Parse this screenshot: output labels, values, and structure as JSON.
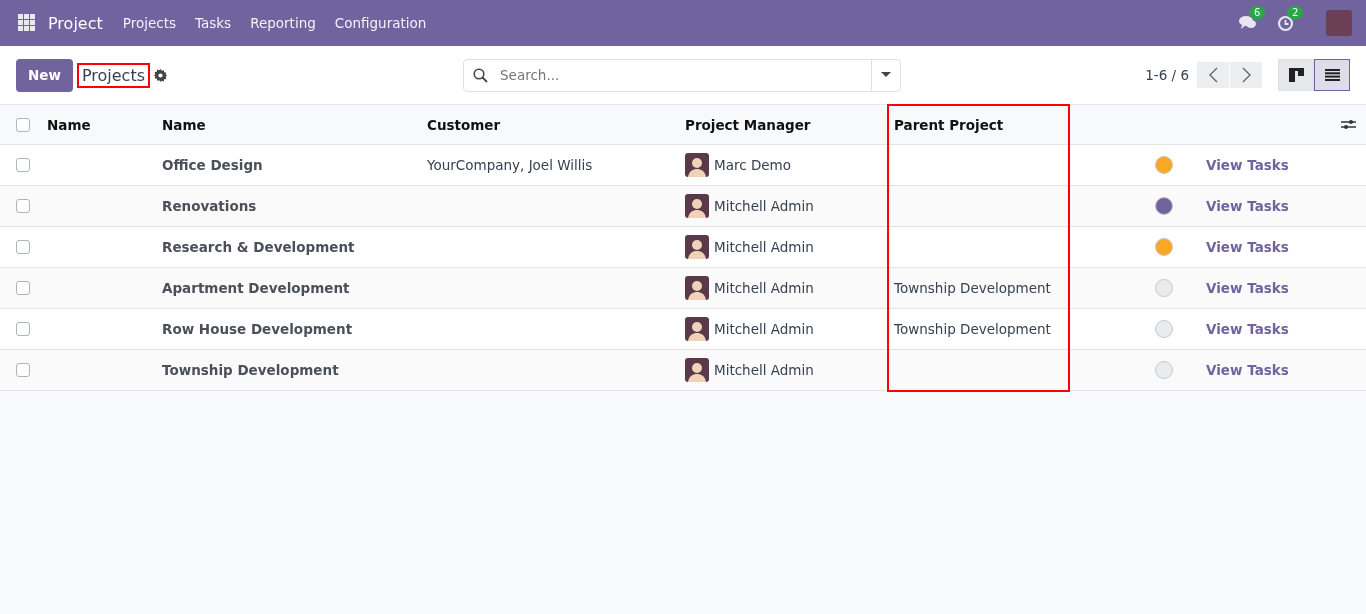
{
  "navbar": {
    "app_name": "Project",
    "menu": [
      "Projects",
      "Tasks",
      "Reporting",
      "Configuration"
    ],
    "messages_badge": "6",
    "activities_badge": "2"
  },
  "control_panel": {
    "new_button": "New",
    "breadcrumb": "Projects",
    "breadcrumb_highlighted": true,
    "search": {
      "placeholder": "Search..."
    },
    "pager": "1-6 / 6",
    "views": [
      {
        "kind": "kanban",
        "selected": false
      },
      {
        "kind": "list",
        "selected": true
      }
    ]
  },
  "table": {
    "all_selected": false,
    "parent_column_highlighted": true,
    "columns": [
      "Name",
      "Name",
      "Customer",
      "Project Manager",
      "Parent Project"
    ],
    "rows": [
      {
        "checked": false,
        "name": "Office Design",
        "customer": "YourCompany, Joel Willis",
        "manager": "Marc Demo",
        "parent": "",
        "color": "#f9a825",
        "action": "View Tasks"
      },
      {
        "checked": false,
        "name": "Renovations",
        "customer": "",
        "manager": "Mitchell Admin",
        "parent": "",
        "color": "#71639e",
        "action": "View Tasks"
      },
      {
        "checked": false,
        "name": "Research & Development",
        "customer": "",
        "manager": "Mitchell Admin",
        "parent": "",
        "color": "#f9a825",
        "action": "View Tasks"
      },
      {
        "checked": false,
        "name": "Apartment Development",
        "customer": "",
        "manager": "Mitchell Admin",
        "parent": "Township Development",
        "color": "#e9ecef",
        "action": "View Tasks"
      },
      {
        "checked": false,
        "name": "Row House Development",
        "customer": "",
        "manager": "Mitchell Admin",
        "parent": "Township Development",
        "color": "#e9ecef",
        "action": "View Tasks"
      },
      {
        "checked": false,
        "name": "Township Development",
        "customer": "",
        "manager": "Mitchell Admin",
        "parent": "",
        "color": "#e9ecef",
        "action": "View Tasks"
      }
    ]
  }
}
